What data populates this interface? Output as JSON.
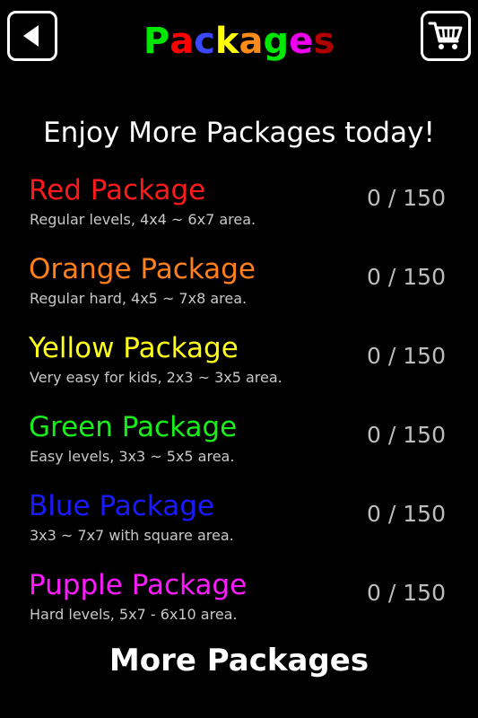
{
  "header": {
    "title_letters": [
      {
        "ch": "P",
        "color": "#00e600"
      },
      {
        "ch": "a",
        "color": "#ff0000"
      },
      {
        "ch": "c",
        "color": "#3a48ff"
      },
      {
        "ch": "k",
        "color": "#ffff00"
      },
      {
        "ch": "a",
        "color": "#ff8c1a"
      },
      {
        "ch": "g",
        "color": "#00e600"
      },
      {
        "ch": "e",
        "color": "#ee00ee"
      },
      {
        "ch": "s",
        "color": "#b00000"
      }
    ],
    "back_icon": "back-arrow-icon",
    "cart_icon": "shopping-cart-icon"
  },
  "subtitle": "Enjoy More Packages today!",
  "packages": [
    {
      "name": "Red Package",
      "desc": "Regular levels, 4x4 ~ 6x7 area.",
      "progress": "0 / 150",
      "color": "#ff1a1a"
    },
    {
      "name": "Orange Package",
      "desc": "Regular hard, 4x5 ~ 7x8 area.",
      "progress": "0 / 150",
      "color": "#ff7f1a"
    },
    {
      "name": "Yellow Package",
      "desc": "Very easy for kids, 2x3 ~ 3x5 area.",
      "progress": "0 / 150",
      "color": "#ffff1a"
    },
    {
      "name": "Green Package",
      "desc": "Easy levels, 3x3 ~ 5x5 area.",
      "progress": "0 / 150",
      "color": "#1aee1a"
    },
    {
      "name": "Blue Package",
      "desc": "3x3 ~ 7x7 with square area.",
      "progress": "0 / 150",
      "color": "#1a1aff"
    },
    {
      "name": "Pupple Package",
      "desc": "Hard levels, 5x7 - 6x10 area.",
      "progress": "0 / 150",
      "color": "#ff1aff"
    }
  ],
  "more_label": "More Packages"
}
